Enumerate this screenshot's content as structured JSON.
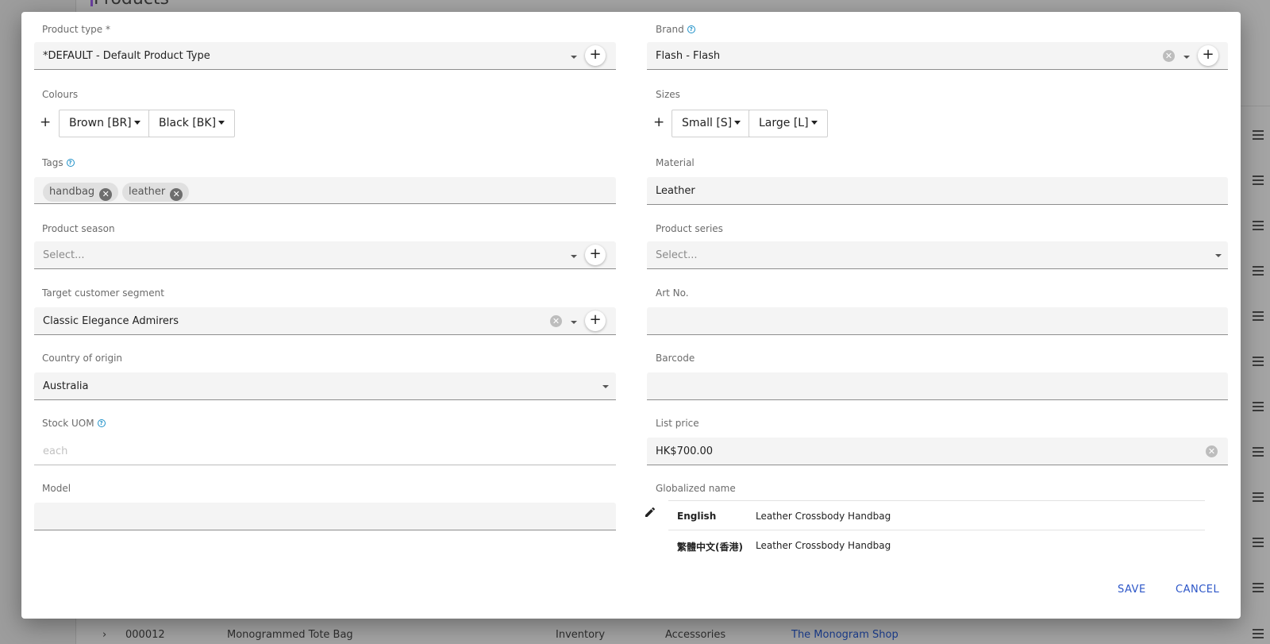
{
  "background": {
    "page_title": "Products",
    "row": {
      "code": "000012",
      "name": "Monogrammed Tote Bag",
      "type": "Inventory",
      "category": "Accessories",
      "vendor": "The Monogram Shop"
    }
  },
  "form": {
    "product_type": {
      "label": "Product type *",
      "value": "*DEFAULT - Default Product Type"
    },
    "brand": {
      "label": "Brand",
      "value": "Flash - Flash"
    },
    "colours": {
      "label": "Colours",
      "add": "+",
      "items": [
        "Brown [BR]",
        "Black [BK]"
      ]
    },
    "sizes": {
      "label": "Sizes",
      "add": "+",
      "items": [
        "Small [S]",
        "Large [L]"
      ]
    },
    "tags": {
      "label": "Tags",
      "items": [
        "handbag",
        "leather"
      ]
    },
    "material": {
      "label": "Material",
      "value": "Leather"
    },
    "product_season": {
      "label": "Product season",
      "placeholder": "Select..."
    },
    "product_series": {
      "label": "Product series",
      "placeholder": "Select..."
    },
    "target_segment": {
      "label": "Target customer segment",
      "value": "Classic Elegance Admirers"
    },
    "art_no": {
      "label": "Art No.",
      "value": ""
    },
    "country": {
      "label": "Country of origin",
      "value": "Australia"
    },
    "barcode": {
      "label": "Barcode",
      "value": ""
    },
    "stock_uom": {
      "label": "Stock UOM",
      "placeholder": "each"
    },
    "list_price": {
      "label": "List price",
      "value": "HK$700.00"
    },
    "model": {
      "label": "Model",
      "value": ""
    },
    "globalized_name": {
      "label": "Globalized name",
      "rows": [
        {
          "lang": "English",
          "name": "Leather Crossbody Handbag"
        },
        {
          "lang": "繁體中文(香港)",
          "name": "Leather Crossbody Handbag"
        }
      ]
    }
  },
  "actions": {
    "save": "SAVE",
    "cancel": "CANCEL"
  },
  "icons": {
    "help": "help-circle-icon",
    "plus": "plus-icon",
    "clear": "clear-icon",
    "edit": "pencil-icon"
  },
  "colors": {
    "accent": "#2c56c8",
    "help": "#1e90c8"
  }
}
